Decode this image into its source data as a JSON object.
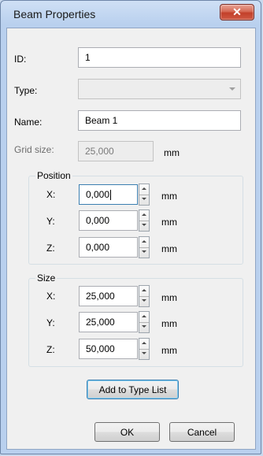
{
  "dialog": {
    "title": "Beam Properties",
    "close_label": "✕"
  },
  "form": {
    "id_label": "ID:",
    "id_value": "1",
    "type_label": "Type:",
    "type_value": "",
    "name_label": "Name:",
    "name_value": "Beam 1",
    "grid_label": "Grid size:",
    "grid_value": "25,000",
    "grid_unit": "mm"
  },
  "position": {
    "title": "Position",
    "rows": [
      {
        "label": "X:",
        "value": "0,000",
        "unit": "mm"
      },
      {
        "label": "Y:",
        "value": "0,000",
        "unit": "mm"
      },
      {
        "label": "Z:",
        "value": "0,000",
        "unit": "mm"
      }
    ]
  },
  "size": {
    "title": "Size",
    "rows": [
      {
        "label": "X:",
        "value": "25,000",
        "unit": "mm"
      },
      {
        "label": "Y:",
        "value": "25,000",
        "unit": "mm"
      },
      {
        "label": "Z:",
        "value": "50,000",
        "unit": "mm"
      }
    ]
  },
  "buttons": {
    "add_to_type_list": "Add to Type List",
    "ok": "OK",
    "cancel": "Cancel"
  }
}
